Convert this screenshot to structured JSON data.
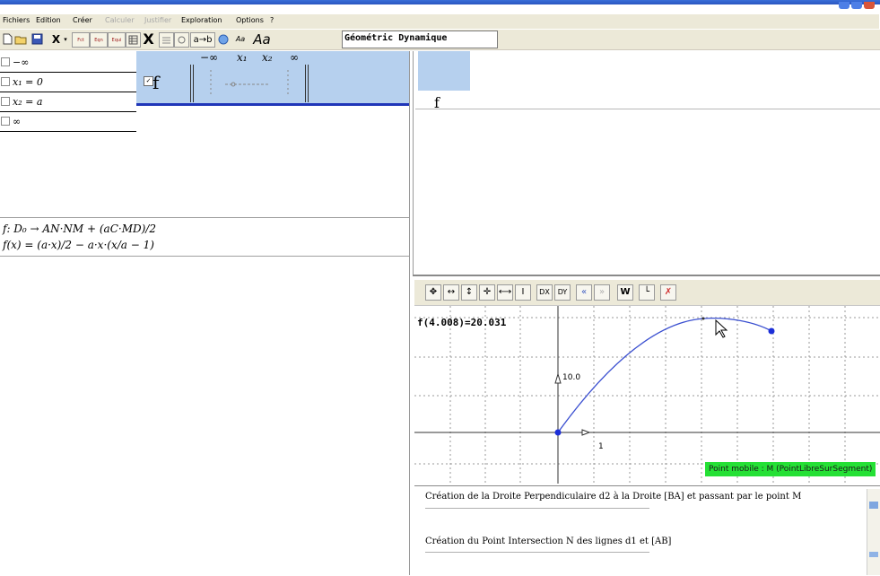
{
  "menu": {
    "items": [
      {
        "label": "Fichiers",
        "enabled": true
      },
      {
        "label": "Edition",
        "enabled": true
      },
      {
        "label": "Créer",
        "enabled": true
      },
      {
        "label": "Calculer",
        "enabled": false
      },
      {
        "label": "Justifier",
        "enabled": false
      },
      {
        "label": "Exploration",
        "enabled": true
      },
      {
        "label": "Options",
        "enabled": true
      },
      {
        "label": "?",
        "enabled": true
      }
    ]
  },
  "toolbar": {
    "geo_label": "Géométric Dynamique",
    "font_a_small": "Aa",
    "font_a_big": "Aa",
    "ab_label": "a→b",
    "cut_label": "X",
    "close_label": "X",
    "btn_fct": "Fct",
    "btn_eqn": "Eqn",
    "btn_equi": "Equi"
  },
  "left": {
    "variables": [
      {
        "text": "−∞"
      },
      {
        "text": "x₁ = 0"
      },
      {
        "text": "x₂ = a"
      },
      {
        "text": "∞"
      }
    ],
    "table_headers": [
      "−∞",
      "x₁",
      "x₂",
      "∞"
    ],
    "function_name": "f",
    "formula_def": "f:  D₀ → AN·NM + (aC·MD)/2",
    "formula_expr": "f(x) = (a·x)/2 − a·x·(x/a − 1)"
  },
  "right": {
    "function_name": "f"
  },
  "graph_toolbar": {
    "buttons": [
      "move-all",
      "move-h",
      "move-v",
      "zoom-all",
      "zoom-h",
      "zoom-v",
      "dx",
      "dy",
      "prev",
      "next",
      "w",
      "axes",
      "delete"
    ]
  },
  "graph": {
    "readout": "f(4.008)=20.031",
    "y_tick_label": "10.0",
    "x_tick_label": "1",
    "status_mobile": "Point mobile : M  (PointLibreSurSegment)"
  },
  "log": {
    "entries": [
      "Création de la Droite Perpendiculaire d2 à la Droite [BA] et passant par le point M",
      "Création du Point Intersection N des lignes d1 et [AB]"
    ]
  },
  "colors": {
    "menu_bg": "#ece9d8",
    "selection_blue": "#b6d0ee",
    "accent_blue": "#1f35b8",
    "status_green": "#25e035",
    "curve_blue": "#3a4fd0"
  }
}
